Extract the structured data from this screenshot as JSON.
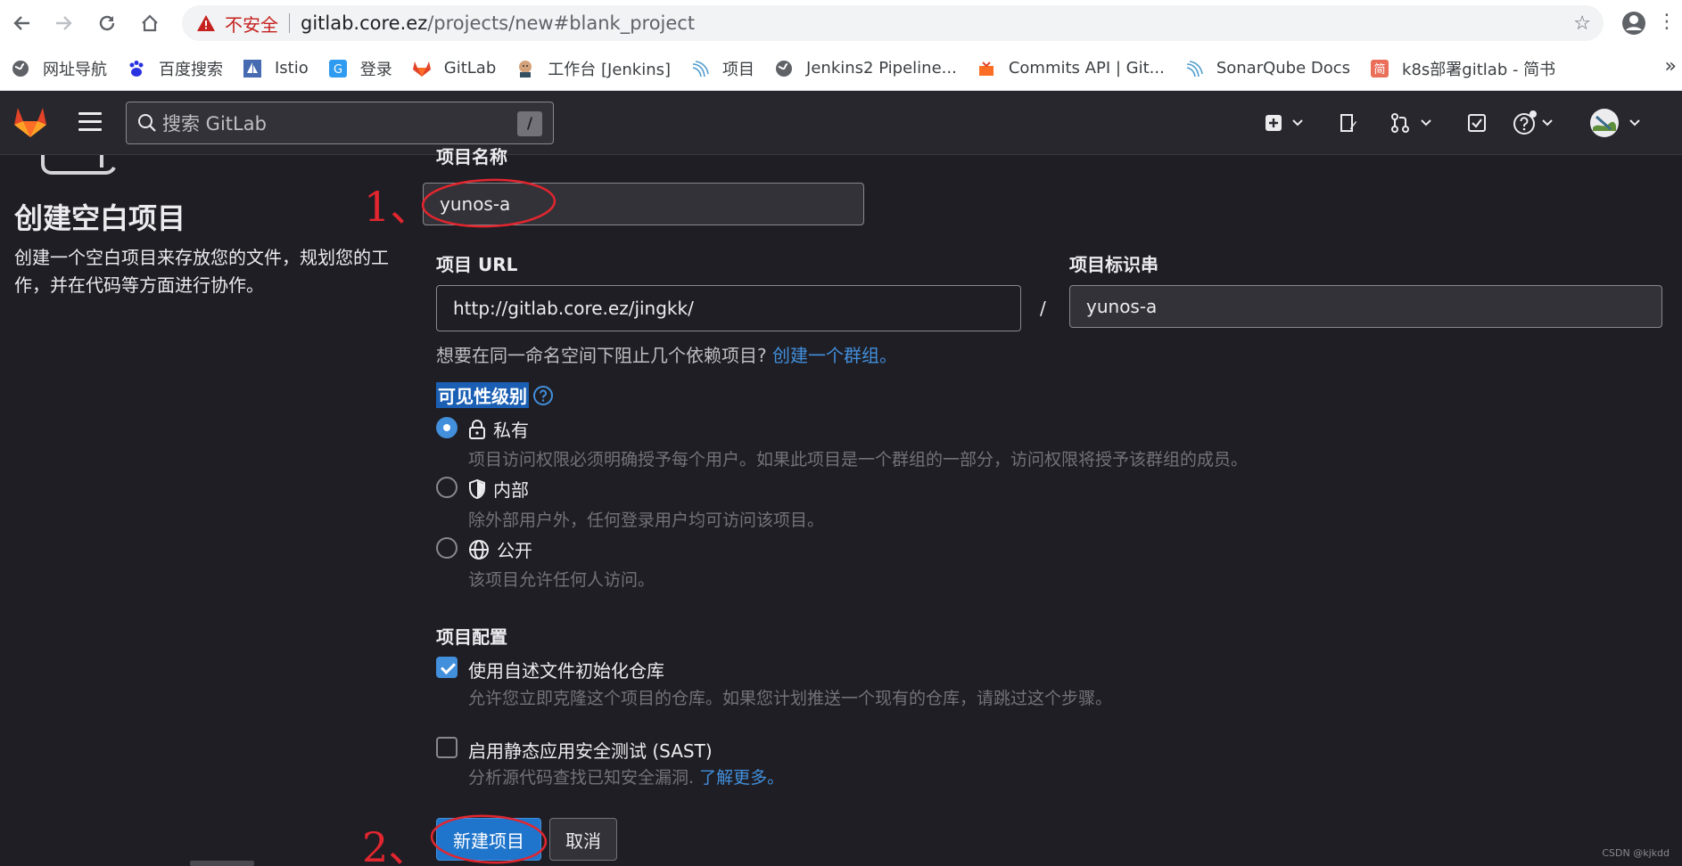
{
  "browser": {
    "insecure_label": "不安全",
    "url_host": "gitlab.core.ez",
    "url_path": "/projects/new#blank_project",
    "bookmarks": [
      {
        "label": "网址导航",
        "icon": "globe-icon"
      },
      {
        "label": "百度搜索",
        "icon": "baidu-paw-icon"
      },
      {
        "label": "Istio",
        "icon": "istio-sail-icon"
      },
      {
        "label": "登录",
        "icon": "login-icon"
      },
      {
        "label": "GitLab",
        "icon": "gitlab-fox-icon"
      },
      {
        "label": "工作台 [Jenkins]",
        "icon": "jenkins-butler-icon"
      },
      {
        "label": "项目",
        "icon": "sonar-wave-icon"
      },
      {
        "label": "Jenkins2 Pipeline...",
        "icon": "globe-icon"
      },
      {
        "label": "Commits API | Git...",
        "icon": "gitlab-box-icon"
      },
      {
        "label": "SonarQube Docs",
        "icon": "sonar-wave-icon"
      },
      {
        "label": "k8s部署gitlab - 简书",
        "icon": "jianshu-icon"
      }
    ],
    "more_label": "»"
  },
  "header": {
    "search_placeholder": "搜索 GitLab",
    "search_shortcut": "/"
  },
  "page": {
    "title": "创建空白项目",
    "description": "创建一个空白项目来存放您的文件，规划您的工作，并在代码等方面进行协作。"
  },
  "form": {
    "name_label": "项目名称",
    "name_value": "yunos-a",
    "url_label": "项目 URL",
    "url_value": "http://gitlab.core.ez/jingkk/",
    "url_separator": "/",
    "slug_label": "项目标识串",
    "slug_value": "yunos-a",
    "group_hint": "想要在同一命名空间下阻止几个依赖项目?",
    "group_link": "创建一个群组。",
    "visibility_label": "可见性级别",
    "visibility_options": [
      {
        "label": "私有",
        "desc": "项目访问权限必须明确授予每个用户。如果此项目是一个群组的一部分，访问权限将授予该群组的成员。",
        "selected": true
      },
      {
        "label": "内部",
        "desc": "除外部用户外，任何登录用户均可访问该项目。",
        "selected": false
      },
      {
        "label": "公开",
        "desc": "该项目允许任何人访问。",
        "selected": false
      }
    ],
    "config_label": "项目配置",
    "readme_label": "使用自述文件初始化仓库",
    "readme_checked": true,
    "readme_desc": "允许您立即克隆这个项目的仓库。如果您计划推送一个现有的仓库，请跳过这个步骤。",
    "sast_label": "启用静态应用安全测试 (SAST)",
    "sast_checked": false,
    "sast_desc": "分析源代码查找已知安全漏洞.",
    "sast_link": "了解更多。",
    "create_button": "新建项目",
    "cancel_button": "取消"
  },
  "annotations": {
    "step1": "1、",
    "step2": "2、"
  },
  "watermark": "CSDN @kjkdd"
}
